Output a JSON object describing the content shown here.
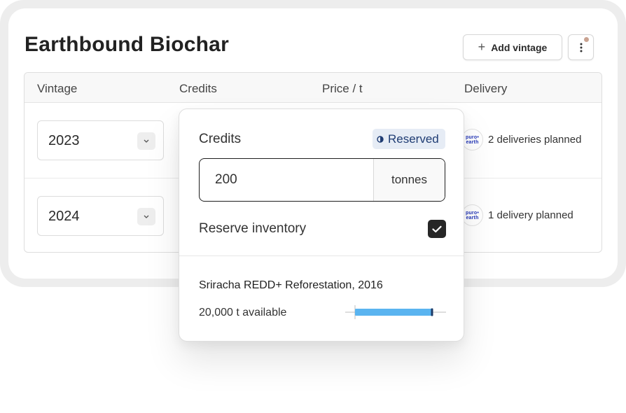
{
  "header": {
    "title": "Earthbound Biochar",
    "add_button_label": "Add vintage"
  },
  "table": {
    "columns": [
      "Vintage",
      "Credits",
      "Price / t",
      "Delivery"
    ],
    "rows": [
      {
        "vintage": "2023",
        "delivery": "2 deliveries planned",
        "logo_text": "puro• earth"
      },
      {
        "vintage": "2024",
        "delivery": "1 delivery planned",
        "logo_text": "puro• earth"
      }
    ]
  },
  "popover": {
    "credits_label": "Credits",
    "status_badge": "Reserved",
    "credits_value": "200",
    "unit": "tonnes",
    "reserve_label": "Reserve inventory",
    "reserve_checked": true,
    "project_name": "Sriracha REDD+ Reforestation, 2016",
    "available_text": "20,000 t available",
    "availability_fraction": 0.85
  },
  "colors": {
    "bar_fill": "#5ab4f0",
    "badge_bg": "#e6ecf5",
    "badge_text": "#1f3c73",
    "logo_text": "#2336b8"
  },
  "icons": [
    "plus-icon",
    "more-vertical-icon",
    "chevron-down-icon",
    "status-dot-icon",
    "checkmark-icon",
    "puro-earth-logo"
  ]
}
